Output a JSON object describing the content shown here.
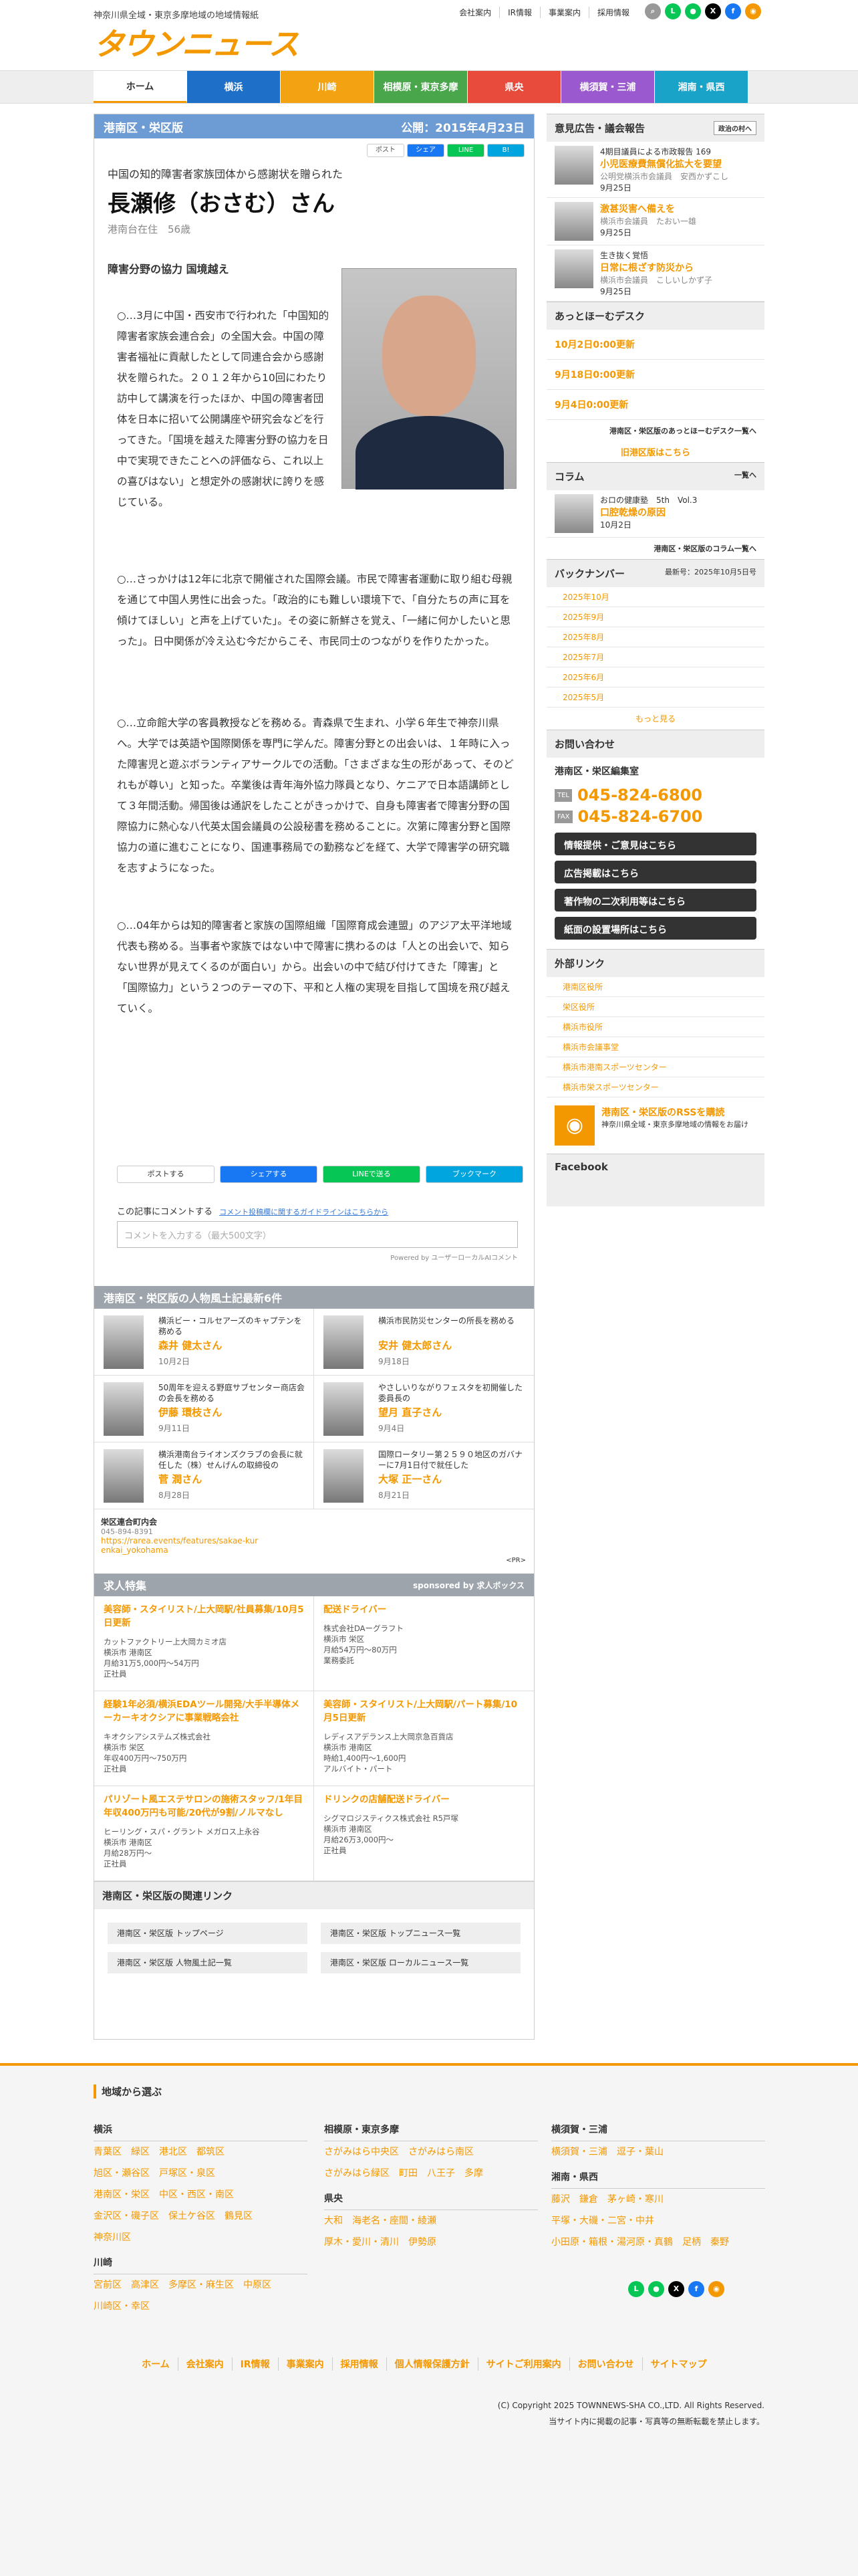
{
  "header": {
    "tagline": "神奈川県全域・東京多摩地域の地域情報紙",
    "logo": "タウンニュース",
    "links": [
      "会社案内",
      "IR情報",
      "事業案内",
      "採用情報"
    ],
    "sns": [
      "search-icon",
      "line-icon",
      "chat-icon",
      "x-icon",
      "facebook-icon",
      "rss-icon"
    ]
  },
  "nav": [
    {
      "label": "ホーム",
      "color": "#ffffff",
      "text": "#333333"
    },
    {
      "label": "横浜",
      "color": "#1d6fc8",
      "text": "#ffffff"
    },
    {
      "label": "川崎",
      "color": "#f3a312",
      "text": "#ffffff"
    },
    {
      "label": "相模原・東京多摩",
      "color": "#4aa64a",
      "text": "#ffffff"
    },
    {
      "label": "県央",
      "color": "#e84a3c",
      "text": "#ffffff"
    },
    {
      "label": "横須賀・三浦",
      "color": "#9b59d0",
      "text": "#ffffff"
    },
    {
      "label": "湘南・県西",
      "color": "#1aa3c8",
      "text": "#ffffff"
    }
  ],
  "article": {
    "edition": "港南区・栄区版",
    "published": "公開：2015年4月23日",
    "share_top": [
      "ポスト",
      "シェア",
      "LINE",
      "B!"
    ],
    "subtitle": "中国の知的障害者家族団体から感謝状を贈られた",
    "title": "長瀬修（おさむ）さん",
    "location": "港南台在住　56歳",
    "heading": "障害分野の協力 国境越え",
    "paragraph1": "○…3月に中国・西安市で行われた「中国知的障害者家族会連合会」の全国大会。中国の障害者福祉に貢献したとして同連合会から感謝状を贈られた。２０１２年から10回にわたり訪中して講演を行ったほか、中国の障害者団体を日本に招いて公開講座や研究会などを行ってきた。「国境を越えた障害分野の協力を日中で実現できたことへの評価なら、これ以上の喜びはない」と想定外の感謝状に誇りを感じている。",
    "paragraph2": "○…さっかけは12年に北京で開催された国際会議。市民で障害者運動に取り組む母親を通じて中国人男性に出会った。「政治的にも難しい環境下で、「自分たちの声に耳を傾けてほしい」と声を上げていた」。その姿に新鮮さを覚え、「一緒に何かしたいと思った」。日中関係が冷え込む今だからこそ、市民同士のつながりを作りたかった。",
    "paragraph3": "○…立命館大学の客員教授などを務める。青森県で生まれ、小学６年生で神奈川県へ。大学では英語や国際関係を専門に学んだ。障害分野との出会いは、１年時に入った障害児と遊ぶボランティアサークルでの活動。「さまざまな生の形があって、そのどれもが尊い」と知った。卒業後は青年海外協力隊員となり、ケニアで日本語講師として３年間活動。帰国後は通訳をしたことがきっかけで、自身も障害者で障害分野の国際協力に熱心な八代英太国会議員の公設秘書を務めることに。次第に障害分野と国際協力の道に進むことになり、国連事務局での勤務などを経て、大学で障害学の研究職を志すようになった。",
    "paragraph4": "○…04年からは知的障害者と家族の国際組織「国際育成会連盟」のアジア太平洋地域代表も務める。当事者や家族ではない中で障害に携わるのは「人との出会いで、知らない世界が見えてくるのが面白い」から。出会いの中で結び付けてきた「障害」と「国際協力」という２つのテーマの下、平和と人権の実現を目指して国境を飛び越えていく。",
    "share_bottom": [
      "ポストする",
      "シェアする",
      "LINEで送る",
      "ブックマーク"
    ],
    "comment_label": "この記事にコメントする",
    "comment_guide": "コメント投稿欄に関するガイドラインはこちらから",
    "comment_placeholder": "コメントを入力する（最大500文字）",
    "powered": "Powered by ユーザーローカルAIコメント"
  },
  "people": {
    "title": "港南区・栄区版の人物風土記最新6件",
    "items": [
      {
        "desc": "横浜ビー・コルセアーズのキャプテンを務める",
        "name": "森井 健太さん",
        "date": "10月2日"
      },
      {
        "desc": "横浜市民防災センターの所長を務める",
        "name": "安井 健太郎さん",
        "date": "9月18日"
      },
      {
        "desc": "50周年を迎える野庭サブセンター商店会の会長を務める",
        "name": "伊藤 環枝さん",
        "date": "9月11日"
      },
      {
        "desc": "やさしいりながりフェスタを初開催した委員長の",
        "name": "望月 直子さん",
        "date": "9月4日"
      },
      {
        "desc": "横浜港南台ライオンズクラブの会長に就任した（株）せんげんの取締役の",
        "name": "菅 潤さん",
        "date": "8月28日"
      },
      {
        "desc": "国際ロータリー第２５９０地区のガバナーに7月1日付で就任した",
        "name": "大塚 正一さん",
        "date": "8月21日"
      }
    ]
  },
  "pr": {
    "name": "栄区連合町内会",
    "phone": "045-894-8391",
    "url": "https://rarea.events/features/sakae-kurenkai_yokohama",
    "tag": "<PR>"
  },
  "jobs": {
    "title": "求人特集",
    "sponsor": "sponsored by 求人ボックス",
    "items": [
      {
        "title": "美容師・スタイリスト/上大岡駅/社員募集/10月5日更新",
        "company": "カットファクトリー上大岡カミオ店",
        "area": "横浜市 港南区",
        "pay": "月給31万5,000円〜54万円",
        "type": "正社員"
      },
      {
        "title": "配送ドライバー",
        "company": "株式会社DAーグラフト",
        "area": "横浜市 栄区",
        "pay": "月給54万円〜80万円",
        "type": "業務委託"
      },
      {
        "title": "経験1年必須/横浜EDAツール開発/大手半導体メーカーキオクシアに事業戦略会社",
        "company": "キオクシアシステムズ株式会社",
        "area": "横浜市 栄区",
        "pay": "年収400万円〜750万円",
        "type": "正社員"
      },
      {
        "title": "美容師・スタイリスト/上大岡駅/パート募集/10月5日更新",
        "company": "レディスアデランス上大岡京急百貨店",
        "area": "横浜市 港南区",
        "pay": "時給1,400円〜1,600円",
        "type": "アルバイト・パート"
      },
      {
        "title": "パリゾート風エステサロンの施術スタッフ/1年目年収400万円も可能/20代が9割/ノルマなし",
        "company": "ヒーリング・スパ・グラント メガロス上永谷",
        "area": "横浜市 港南区",
        "pay": "月給28万円〜",
        "type": "正社員"
      },
      {
        "title": "ドリンクの店舗配送ドライバー",
        "company": "シグマロジスティクス株式会社 R5戸塚",
        "area": "横浜市 港南区",
        "pay": "月給26万3,000円〜",
        "type": "正社員"
      }
    ]
  },
  "related": {
    "title": "港南区・栄区版の関連リンク",
    "items": [
      "港南区・栄区版 トップページ",
      "港南区・栄区版 トップニュース一覧",
      "港南区・栄区版 人物風土記一覧",
      "港南区・栄区版 ローカルニュース一覧"
    ]
  },
  "sidebar": {
    "ads_title": "意見広告・議会報告",
    "ads_more": "政治の村へ",
    "ads": [
      {
        "sub": "4期目議員による市政報告 169",
        "title": "小児医療費無償化拡大を要望",
        "by": "公明党横浜市会議員　安西かずこし",
        "date": "9月25日"
      },
      {
        "sub": "",
        "title": "激甚災害へ備えを",
        "by": "横浜市会議員　たおい一雄",
        "date": "9月25日"
      },
      {
        "sub": "生き抜く覚悟",
        "title": "日常に根ざす防災から",
        "by": "横浜市会議員　こしいしかず子",
        "date": "9月25日"
      }
    ],
    "desk_title": "あっとほーむデスク",
    "desk": [
      "10月2日0:00更新",
      "9月18日0:00更新",
      "9月4日0:00更新"
    ],
    "desk_more": "港南区・栄区版のあっとほーむデスク一覧へ",
    "ed_past": "旧港区版はこちら",
    "col_title": "コラム",
    "col_more": "一覧へ",
    "col": {
      "sub": "おロの健康塾　5th　Vol.3",
      "title": "口腔乾燥の原因",
      "date": "10月2日"
    },
    "col_list": "港南区・栄区版のコラム一覧へ",
    "bn_title": "バックナンバー",
    "bn_latest": "最新号：2025年10月5日号",
    "bn": [
      "2025年10月",
      "2025年9月",
      "2025年8月",
      "2025年7月",
      "2025年6月",
      "2025年5月"
    ],
    "bn_more": "もっと見る",
    "ct_title": "お問い合わせ",
    "ct_office": "港南区・栄区編集室",
    "tel": "045-824-6800",
    "fax": "045-824-6700",
    "ct_btns": [
      "情報提供・ご意見はこちら",
      "広告掲載はこちら",
      "著作物の二次利用等はこちら",
      "紙面の設置場所はこちら"
    ],
    "ext_title": "外部リンク",
    "ext": [
      "港南区役所",
      "栄区役所",
      "横浜市役所",
      "横浜市会議事堂",
      "横浜市港南スポーツセンター",
      "横浜市栄スポーツセンター"
    ],
    "rss_title": "港南区・栄区版のRSSを購読",
    "rss_desc": "神奈川県全域・東京多摩地域の情報をお届け",
    "fb": "Facebook"
  },
  "footer": {
    "region_title": "地域から選ぶ",
    "yokohama": "横浜",
    "yk_links": [
      "青葉区",
      "緑区",
      "港北区",
      "都筑区",
      "旭区・瀬谷区",
      "戸塚区・泉区",
      "港南区・栄区",
      "中区・西区・南区",
      "金沢区・磯子区",
      "保土ケ谷区",
      "鶴見区",
      "神奈川区"
    ],
    "kawasaki": "川崎",
    "kw_links": [
      "宮前区",
      "高津区",
      "多摩区・麻生区",
      "中原区",
      "川崎区・幸区"
    ],
    "sagami": "相模原・東京多摩",
    "sg_links": [
      "さがみはら中央区",
      "さがみはら南区",
      "さがみはら緑区",
      "町田",
      "八王子",
      "多摩"
    ],
    "kenou": "県央",
    "ko_links": [
      "大和",
      "海老名・座間・綾瀬",
      "厚木・愛川・清川",
      "伊勢原"
    ],
    "yokosuka": "横須賀・三浦",
    "ys_links": [
      "横須賀・三浦",
      "逗子・葉山"
    ],
    "shonan": "湘南・県西",
    "sh_links": [
      "藤沢",
      "鎌倉",
      "茅ヶ崎・寒川",
      "平塚・大磯・二宮・中井",
      "小田原・箱根・湯河原・真鶴",
      "足柄",
      "秦野"
    ],
    "bottom": [
      "ホーム",
      "会社案内",
      "IR情報",
      "事業案内",
      "採用情報",
      "個人情報保護方針",
      "サイトご利用案内",
      "お問い合わせ",
      "サイトマップ"
    ],
    "copyright": "(C) Copyright 2025 TOWNNEWS-SHA CO.,LTD. All Rights Reserved.",
    "notice": "当サイト内に掲載の記事・写真等の無断転載を禁止します。"
  }
}
